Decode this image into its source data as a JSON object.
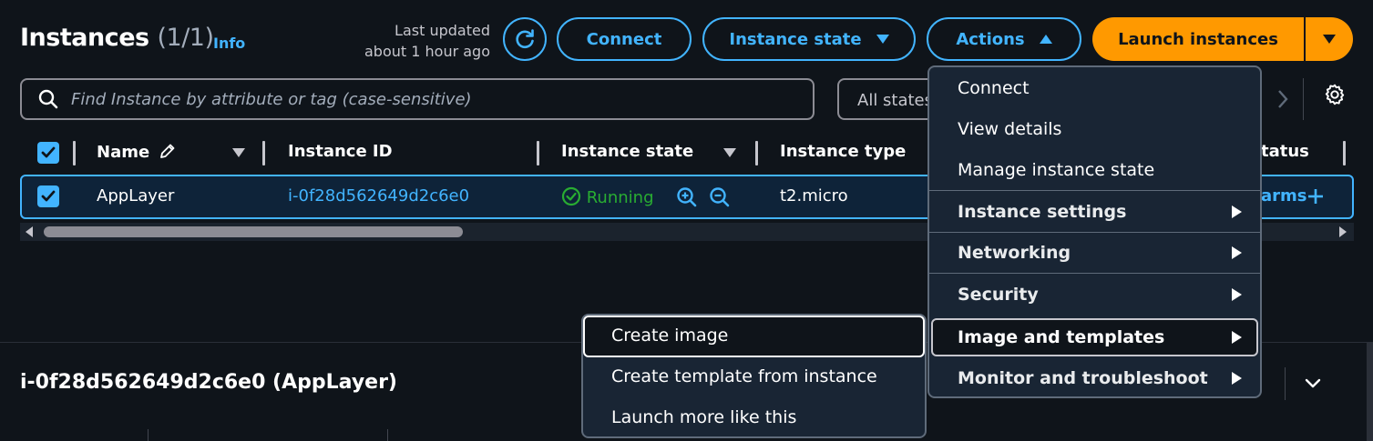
{
  "header": {
    "title": "Instances",
    "count": "(1/1)",
    "info_link": "Info",
    "last_updated_line1": "Last updated",
    "last_updated_line2": "about 1 hour ago"
  },
  "toolbar": {
    "connect_label": "Connect",
    "instance_state_label": "Instance state",
    "actions_label": "Actions",
    "launch_label": "Launch instances"
  },
  "search": {
    "placeholder": "Find Instance by attribute or tag (case-sensitive)",
    "state_filter": "All states"
  },
  "table": {
    "columns": [
      "Name",
      "Instance ID",
      "Instance state",
      "Instance type",
      "Status"
    ],
    "column_visible_fragment": "tatus",
    "rows": [
      {
        "name": "AppLayer",
        "instance_id": "i-0f28d562649d2c6e0",
        "state": "Running",
        "type": "t2.micro",
        "alarms_fragment": "arms"
      }
    ]
  },
  "detail": {
    "title": "i-0f28d562649d2c6e0 (AppLayer)"
  },
  "actions_menu": {
    "items": [
      {
        "label": "Connect",
        "submenu": false
      },
      {
        "label": "View details",
        "submenu": false
      },
      {
        "label": "Manage instance state",
        "submenu": false
      },
      {
        "label": "Instance settings",
        "submenu": true
      },
      {
        "label": "Networking",
        "submenu": true
      },
      {
        "label": "Security",
        "submenu": true
      },
      {
        "label": "Image and templates",
        "submenu": true
      },
      {
        "label": "Monitor and troubleshoot",
        "submenu": true
      }
    ]
  },
  "image_submenu": {
    "items": [
      "Create image",
      "Create template from instance",
      "Launch more like this"
    ]
  },
  "colors": {
    "accent": "#42b4ff",
    "primary": "#ff9900",
    "running": "#29ad32",
    "background": "#0f141a"
  },
  "icons": [
    "refresh-icon",
    "search-icon",
    "gear-icon",
    "edit-icon",
    "zoom-in-icon",
    "zoom-out-icon",
    "check-circle-icon",
    "plus-icon",
    "chevron-down-icon",
    "chevron-right-icon"
  ]
}
